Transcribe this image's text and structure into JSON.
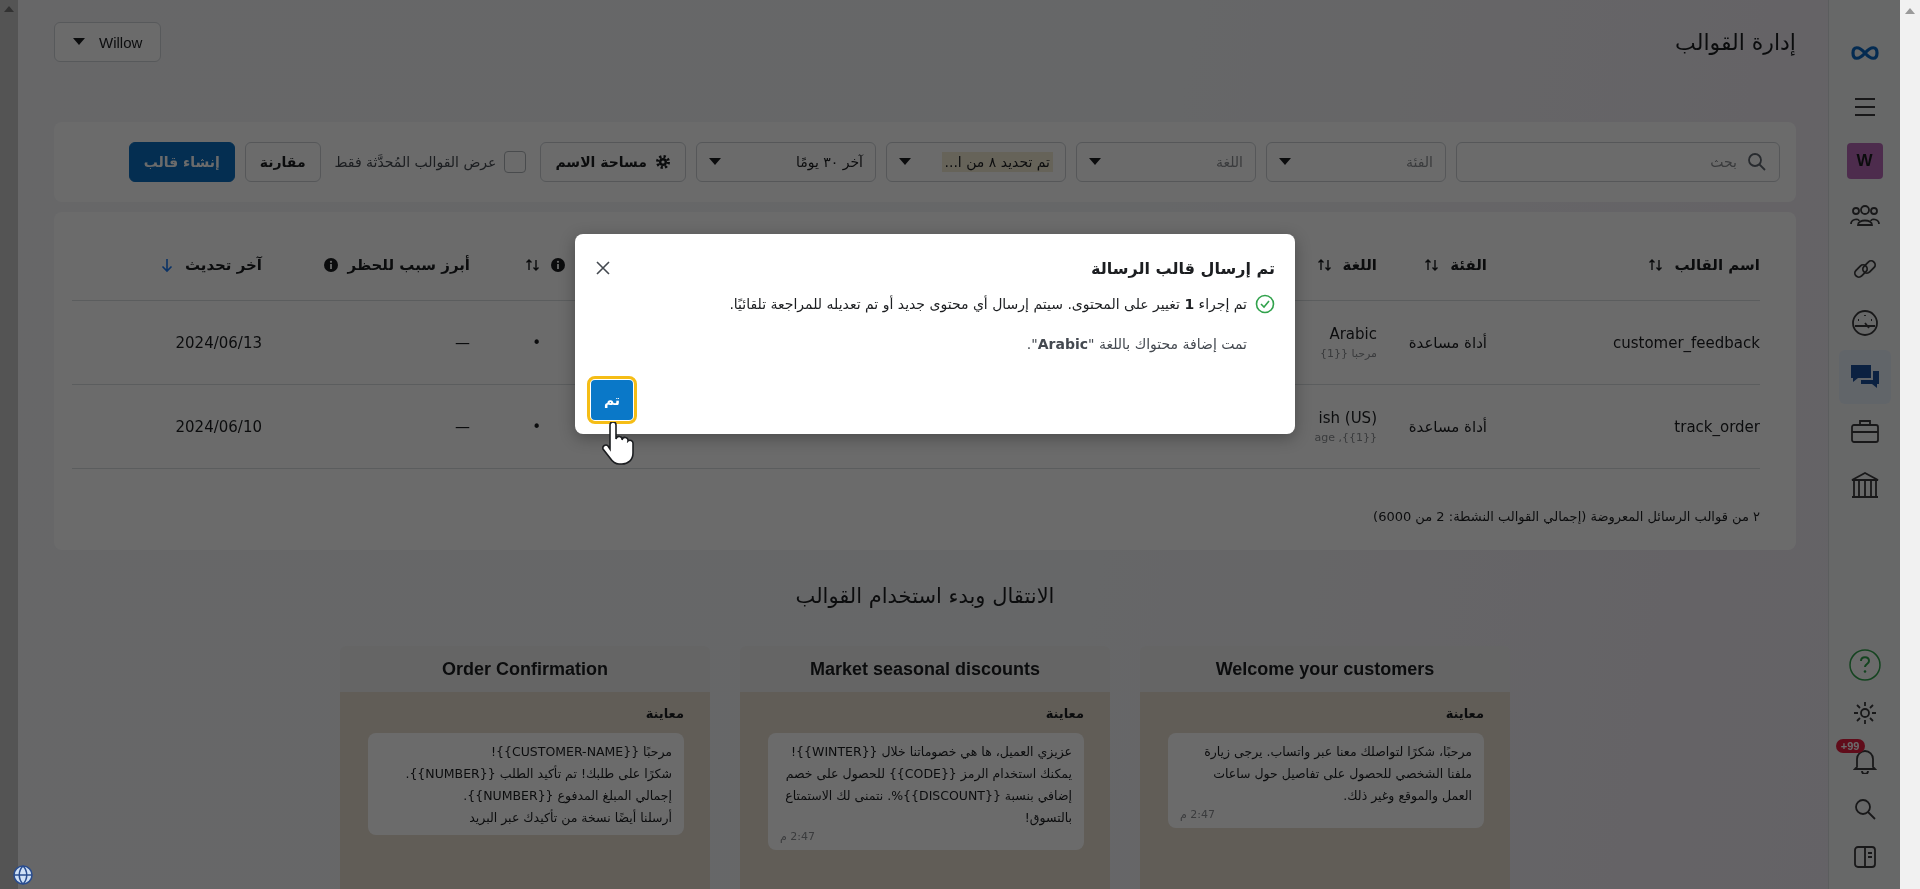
{
  "header": {
    "account_dropdown": "Willow",
    "title": "إدارة القوالب"
  },
  "filters": {
    "search": {
      "placeholder": "بحث"
    },
    "dropdowns": [
      {
        "placeholder": "الفئة"
      },
      {
        "placeholder": "اللغة"
      },
      {
        "value": "تم تحديد ٨ من ا...",
        "highlighted": true
      },
      {
        "value": "آخر ٣٠ يومًا",
        "highlighted": false
      }
    ],
    "namespace_button": "مساحة الاسم",
    "updated_only": {
      "label": "عرض القوالب المُحدَّثة فقط",
      "checked": false
    },
    "compare_button": "مقارنة",
    "create_button": "إنشاء قالب"
  },
  "table": {
    "columns": [
      {
        "label": "اسم القالب",
        "sortable": true,
        "sorted": false,
        "info": false
      },
      {
        "label": "الفئة",
        "sortable": true,
        "sorted": false,
        "info": false
      },
      {
        "label": "اللغة",
        "sortable": true,
        "sorted": false,
        "info": false
      },
      {
        "sortable": true,
        "sorted": false,
        "info": true
      },
      {
        "label": "أبرز سبب للحظر",
        "sortable": false,
        "info": true
      },
      {
        "label": "آخر تحديث",
        "sortable": true,
        "sorted": true,
        "info": false
      }
    ],
    "rows": [
      {
        "name": "customer_feedback",
        "category": "أداة مساعدة",
        "language": "Arabic",
        "preview": "مرحبا {{1}",
        "column_4": "•",
        "block_reason": "—",
        "updated": "2024/06/13"
      },
      {
        "name": "track_order",
        "category": "أداة مساعدة",
        "language": "ish (US)",
        "preview": "age ,{{1}}",
        "column_4": "•",
        "block_reason": "—",
        "updated": "2024/06/10"
      }
    ],
    "footer": "٢ من قوالب الرسائل المعروضة (إجمالي القوالب النشطة: 2 من 6000)"
  },
  "section_title": "الانتقال وبدء استخدام القوالب",
  "sample_cards": [
    {
      "title": "Welcome your customers",
      "preview_label": "معاينة",
      "message": [
        "مرحبًا، شكرًا لتواصلك معنا عبر واتساب. يرجى زيارة ملفنا الشخصي للحصول على تفاصيل حول ساعات العمل والموقع وغير ذلك."
      ],
      "time": "2:47 م"
    },
    {
      "title": "Market seasonal discounts",
      "preview_label": "معاينة",
      "message": [
        "عزيزي العميل، ها هي خصوماتنا خلال {{WINTER}}! يمكنك استخدام الرمز {{CODE}} للحصول على خصم إضافي بنسبة {{DISCOUNT}}%. نتمنى لك الاستمتاع بالتسوق!"
      ],
      "time": "2:47 م"
    },
    {
      "title": "Order Confirmation",
      "preview_label": "معاينة",
      "message": [
        "مرحبًا {{CUSTOMER-NAME}}!",
        "شكرًا على طلبك! تم تأكيد الطلب {{NUMBER}}.",
        "إجمالي المبلغ المدفوع {{NUMBER}}.",
        "أرسلنا أيضًا نسخة من تأكيدك عبر البريد"
      ]
    }
  ],
  "nav": {
    "top": [
      {
        "kind": "logo"
      },
      {
        "kind": "menu",
        "selected": false
      },
      {
        "kind": "avatar",
        "label": "W"
      },
      {
        "kind": "people",
        "selected": false
      },
      {
        "kind": "link",
        "selected": false
      },
      {
        "kind": "gauge",
        "selected": false
      },
      {
        "kind": "chat",
        "selected": true
      },
      {
        "kind": "briefcase",
        "selected": false
      },
      {
        "kind": "bank",
        "selected": false
      }
    ],
    "bottom": [
      {
        "kind": "help"
      },
      {
        "kind": "settings",
        "selected": false
      },
      {
        "kind": "bell",
        "badge": "+99",
        "selected": false
      },
      {
        "kind": "search",
        "selected": false
      },
      {
        "kind": "panel",
        "selected": false
      }
    ]
  },
  "modal": {
    "title": "تم إرسال قالب الرسالة",
    "messages": [
      {
        "kind": "success",
        "text": "تم إجراء **1** تغيير على المحتوى. سيتم إرسال أي محتوى جديد أو تم تعديله للمراجعة تلقائيًا."
      },
      {
        "kind": "plain",
        "text": "تمت إضافة محتواك باللغة \"**Arabic**\"."
      }
    ],
    "button": {
      "label": "تم",
      "focused": true
    }
  }
}
